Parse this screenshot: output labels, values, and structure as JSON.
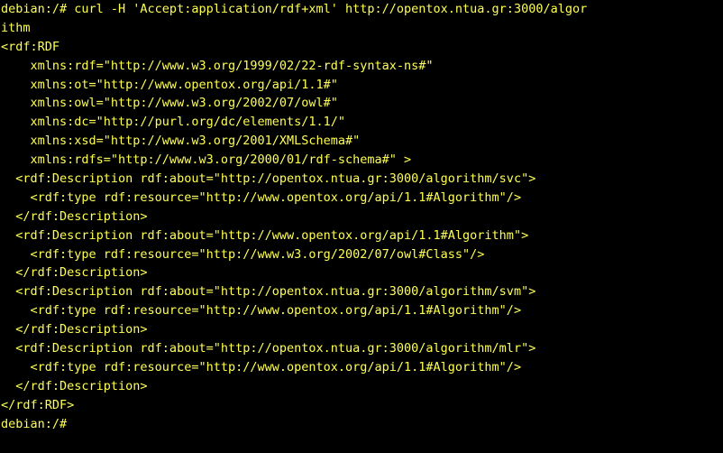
{
  "terminal": {
    "colors": {
      "background": "#000000",
      "text": "#ffff55"
    },
    "lines": [
      "debian:/# curl -H 'Accept:application/rdf+xml' http://opentox.ntua.gr:3000/algor",
      "ithm",
      "<rdf:RDF",
      "    xmlns:rdf=\"http://www.w3.org/1999/02/22-rdf-syntax-ns#\"",
      "    xmlns:ot=\"http://www.opentox.org/api/1.1#\"",
      "    xmlns:owl=\"http://www.w3.org/2002/07/owl#\"",
      "    xmlns:dc=\"http://purl.org/dc/elements/1.1/\"",
      "    xmlns:xsd=\"http://www.w3.org/2001/XMLSchema#\"",
      "    xmlns:rdfs=\"http://www.w3.org/2000/01/rdf-schema#\" >",
      "  <rdf:Description rdf:about=\"http://opentox.ntua.gr:3000/algorithm/svc\">",
      "    <rdf:type rdf:resource=\"http://www.opentox.org/api/1.1#Algorithm\"/>",
      "  </rdf:Description>",
      "  <rdf:Description rdf:about=\"http://www.opentox.org/api/1.1#Algorithm\">",
      "    <rdf:type rdf:resource=\"http://www.w3.org/2002/07/owl#Class\"/>",
      "  </rdf:Description>",
      "  <rdf:Description rdf:about=\"http://opentox.ntua.gr:3000/algorithm/svm\">",
      "    <rdf:type rdf:resource=\"http://www.opentox.org/api/1.1#Algorithm\"/>",
      "  </rdf:Description>",
      "  <rdf:Description rdf:about=\"http://opentox.ntua.gr:3000/algorithm/mlr\">",
      "    <rdf:type rdf:resource=\"http://www.opentox.org/api/1.1#Algorithm\"/>",
      "  </rdf:Description>",
      "</rdf:RDF>",
      "debian:/#"
    ]
  }
}
